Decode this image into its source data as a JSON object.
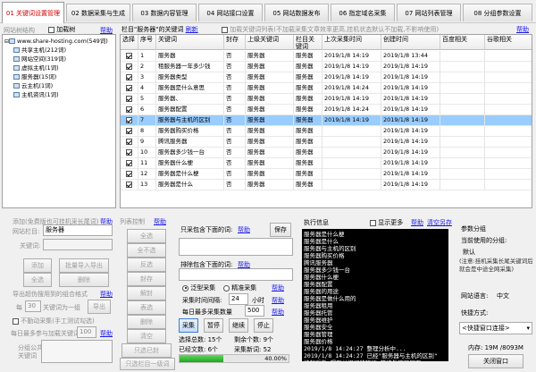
{
  "tabs": [
    {
      "label": "01 关键词设置管理",
      "active": true
    },
    {
      "label": "02 数据采集与生成",
      "active": false
    },
    {
      "label": "03 数据内容管理",
      "active": false
    },
    {
      "label": "04 网站接口设置",
      "active": false
    },
    {
      "label": "05 网站数据发布",
      "active": false
    },
    {
      "label": "06 指定域名采集",
      "active": false
    },
    {
      "label": "07 网站列表管理",
      "active": false
    },
    {
      "label": "08 分组参数设置",
      "active": false
    }
  ],
  "tree": {
    "header": "网站树结构",
    "load_tree": "加载树",
    "help": "帮助",
    "items": [
      {
        "label": "www.share-hosting.com(549词)",
        "level": 0
      },
      {
        "label": "共享主机(212词)",
        "level": 1
      },
      {
        "label": "网站空间(319词)",
        "level": 1
      },
      {
        "label": "虚拟主机(1词)",
        "level": 1
      },
      {
        "label": "服务器(15词)",
        "level": 1
      },
      {
        "label": "云主机(1词)",
        "level": 1
      },
      {
        "label": "主机资讯(1词)",
        "level": 1
      }
    ]
  },
  "grid": {
    "title": "栏目\"服务器\"的关键词",
    "refresh": "刷新",
    "option": "加载关键词列表(不加载采集文章效率更高,挂机状态默认不加载,不影响使用)",
    "help": "帮助",
    "columns": [
      "选择",
      "序号",
      "关键词",
      "封存",
      "上级关键词",
      "栏目关键词",
      "上次采集时间",
      "创建时间",
      "百度相关",
      "谷歌相关"
    ],
    "rows": [
      {
        "sel": true,
        "no": "1",
        "kw": "服务器",
        "seal": "否",
        "parent": "服务器",
        "col": "服务器",
        "last": "2019/1/8 14:19",
        "created": "2019/1/8 13:44",
        "highlight": false
      },
      {
        "sel": true,
        "no": "2",
        "kw": "租服务器一年多少钱",
        "seal": "否",
        "parent": "服务器",
        "col": "服务器",
        "last": "2019/1/8 14:19",
        "created": "2019/1/8 14:19",
        "highlight": false
      },
      {
        "sel": true,
        "no": "3",
        "kw": "服务器类型",
        "seal": "否",
        "parent": "服务器",
        "col": "服务器",
        "last": "2019/1/8 14:19",
        "created": "2019/1/8 14:19",
        "highlight": false
      },
      {
        "sel": true,
        "no": "4",
        "kw": "服务器是什么意思",
        "seal": "否",
        "parent": "服务器",
        "col": "服务器",
        "last": "2019/1/8 14:24",
        "created": "2019/1/8 14:19",
        "highlight": false
      },
      {
        "sel": true,
        "no": "5",
        "kw": "服务器、",
        "seal": "否",
        "parent": "服务器",
        "col": "服务器",
        "last": "2019/1/8 14:19",
        "created": "2019/1/8 14:19",
        "highlight": false
      },
      {
        "sel": true,
        "no": "6",
        "kw": "服务器配置",
        "seal": "否",
        "parent": "服务器",
        "col": "服务器",
        "last": "2019/1/8 14:24",
        "created": "2019/1/8 14:19",
        "highlight": false
      },
      {
        "sel": true,
        "no": "7",
        "kw": "服务器与主机的区别",
        "seal": "否",
        "parent": "服务器",
        "col": "服务器",
        "last": "2019/1/8 14:19",
        "created": "2019/1/8 14:19",
        "highlight": true
      },
      {
        "sel": true,
        "no": "8",
        "kw": "服务器购买价格",
        "seal": "否",
        "parent": "服务器",
        "col": "服务器",
        "last": "",
        "created": "2019/1/8 14:19",
        "highlight": false
      },
      {
        "sel": true,
        "no": "9",
        "kw": "腾讯服务器",
        "seal": "否",
        "parent": "服务器",
        "col": "服务器",
        "last": "",
        "created": "2019/1/8 14:19",
        "highlight": false
      },
      {
        "sel": true,
        "no": "10",
        "kw": "服务器多少钱一台",
        "seal": "否",
        "parent": "服务器",
        "col": "服务器",
        "last": "",
        "created": "2019/1/8 14:19",
        "highlight": false
      },
      {
        "sel": true,
        "no": "11",
        "kw": "服务器什么梗",
        "seal": "否",
        "parent": "服务器",
        "col": "服务器",
        "last": "",
        "created": "2019/1/8 14:19",
        "highlight": false
      },
      {
        "sel": true,
        "no": "12",
        "kw": "服务器是什么梗",
        "seal": "否",
        "parent": "服务器",
        "col": "服务器",
        "last": "",
        "created": "2019/1/8 14:19",
        "highlight": false
      },
      {
        "sel": true,
        "no": "13",
        "kw": "服务器是什么",
        "seal": "否",
        "parent": "服务器",
        "col": "服务器",
        "last": "",
        "created": "2019/1/8 14:19",
        "highlight": false
      }
    ]
  },
  "addkw": {
    "header": "添加(免费版也可挂机采长尾词)",
    "help": "帮助",
    "site_kw_label": "网站栏目:",
    "site_kw_value": "服务器",
    "kw_label": "关键词:",
    "add": "添加",
    "batch_import": "批量导入导出",
    "select_all": "全选",
    "delete": "删除",
    "export_label": "导出超伪搜用到的组合格式",
    "help2": "帮助",
    "per_label": "每",
    "per_value": "30",
    "kw_group": "关键词为一组",
    "export": "导出",
    "no_collect": "不勤动采集(手工测试勾选)",
    "daily_label": "每日最多参与加载关键词",
    "daily_value": "100",
    "group_note_1": "分组公共",
    "group_note_2": "关键词",
    "daily_help": "帮助"
  },
  "list_ctrl": {
    "header": "列表控制",
    "help": "帮助",
    "buttons": [
      "全选",
      "全不选",
      "反选",
      "封存",
      "解封",
      "表选",
      "删除",
      "清空",
      "只选已封",
      "只选栏目一级词"
    ]
  },
  "filter": {
    "include_label": "只采包含下面的词:",
    "include_help": "帮助",
    "save": "保存",
    "exclude_label": "排除包含下面的词:",
    "exclude_help": "帮助",
    "mode_broad": "泛型采集",
    "mode_exact": "精准采集",
    "help": "帮助",
    "interval_label": "采集时间间隔:",
    "interval_value": "24",
    "interval_unit": "小时",
    "help2": "帮助",
    "max_label": "每日最多采集数量",
    "max_value": "500",
    "help3": "帮助",
    "buttons": [
      "采集",
      "暂停",
      "继续",
      "停止"
    ],
    "stat_col": "选择总数: 15个",
    "stat_left": "剩余个数: 9个",
    "stat_done": "已经文数: 6个",
    "stat_new": "采集新词: 52",
    "progress": 0.4,
    "progress_text": "40.00%"
  },
  "log": {
    "header": "执行信息",
    "show_more": "显示更多",
    "help": "帮助",
    "clear": "清空",
    "save": "另存",
    "lines": [
      "服务器是什么梗",
      "服务器是什么",
      "服务器与主机的区别",
      "服务器购买价格",
      "腾讯服务器",
      "服务器多少钱一台",
      "服务器什么梗",
      "服务器配置",
      "服务器的用途",
      "服务器是做什么用的",
      "服务器租用",
      "服务器托管",
      "服务器维护",
      "服务器安全",
      "服务器管理",
      "服务器价格",
      "2019/1/8 14:24:27  整理分析中...",
      "2019/1/8 14:24:27  已经\"服务器与主机的区别\"",
      "  挂起采集,提取关键词的建议,等待处理的网页"
    ]
  },
  "params": {
    "header": "参数分组",
    "current_label": "当前使用的分组:",
    "current_value": "默认",
    "note": "(注意:挂机采集长尾关键词后就会是中途全网采集)",
    "lang_label": "网站语言:",
    "lang_value": "中文",
    "quick_label": "快捷方式:",
    "quick_select": "<快捷窗口连接>",
    "memory": "内存: 19M /8093M",
    "close": "关闭窗口"
  }
}
